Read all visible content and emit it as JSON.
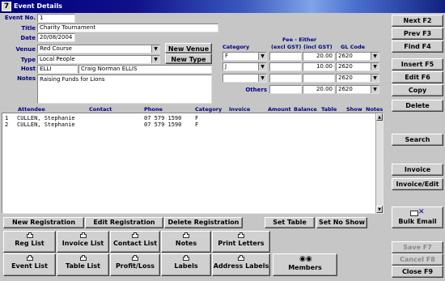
{
  "window": {
    "title": "Event Details"
  },
  "form": {
    "event_no_label": "Event No.",
    "event_no": "1",
    "title_label": "Title",
    "title": "Charity Tournament",
    "date_label": "Date",
    "date": "20/08/2004",
    "venue_label": "Venue",
    "venue": "Red Course",
    "type_label": "Type",
    "type": "Local People",
    "host_label": "Host",
    "host_code": "ELLI",
    "host_name": "Craig Norman ELLIS",
    "notes_label": "Notes",
    "notes": "Raising Funds for Lions",
    "new_venue": "New Venue",
    "new_type": "New Type"
  },
  "fees": {
    "category_header": "Category",
    "fee_header": "Fee - Either",
    "excl_header": "(excl GST)",
    "incl_header": "(incl GST)",
    "gl_header": "GL Code",
    "rows": [
      {
        "category": "F",
        "excl": "",
        "incl": "20.00",
        "gl": "2620"
      },
      {
        "category": "J",
        "excl": "",
        "incl": "10.00",
        "gl": "2620"
      },
      {
        "category": "",
        "excl": "",
        "incl": "",
        "gl": "2620"
      }
    ],
    "others_label": "Others",
    "others": {
      "excl": "",
      "incl": "20.00",
      "gl": "2620"
    }
  },
  "table": {
    "headers": {
      "attendee": "Attendee",
      "contact": "Contact",
      "phone": "Phone",
      "category": "Category",
      "invoice": "Invoice",
      "amount": "Amount",
      "balance": "Balance",
      "table": "Table",
      "show": "Show",
      "notes": "Notes"
    },
    "rows": [
      {
        "num": "1",
        "attendee": "CULLEN, Stephanie",
        "phone": "07 579 1590",
        "category": "F"
      },
      {
        "num": "2",
        "attendee": "CULLEN, Stephanie",
        "phone": "07 579 1590",
        "category": "F"
      }
    ]
  },
  "side_buttons": {
    "next": "Next F2",
    "prev": "Prev F3",
    "find": "Find F4",
    "insert": "Insert F5",
    "edit": "Edit F6",
    "copy": "Copy",
    "delete": "Delete",
    "search": "Search",
    "invoice": "Invoice",
    "invoice_edit": "Invoice/Edit",
    "bulk_email": "Bulk Email",
    "save": "Save F7",
    "cancel": "Cancel F8",
    "close": "Close F9"
  },
  "registration": {
    "new": "New Registration",
    "edit": "Edit Registration",
    "delete": "Delete Registration",
    "set_table": "Set Table",
    "set_no_show": "Set No Show"
  },
  "reports": {
    "reg_list": "Reg List",
    "invoice_list": "Invoice List",
    "contact_list": "Contact List",
    "notes": "Notes",
    "print_letters": "Print Letters",
    "event_list": "Event List",
    "table_list": "Table List",
    "profit_loss": "Profit/Loss",
    "labels": "Labels",
    "address_labels": "Address Labels",
    "members": "Members"
  },
  "icons": {
    "title": "event-app-icon",
    "dropdown": "chevron-down-icon",
    "printer": "printer-icon",
    "members": "binoculars-icon",
    "email": "email-icon"
  },
  "colors": {
    "label": "#000080",
    "titlebar": "#000080",
    "panel": "#c6c6c6"
  }
}
